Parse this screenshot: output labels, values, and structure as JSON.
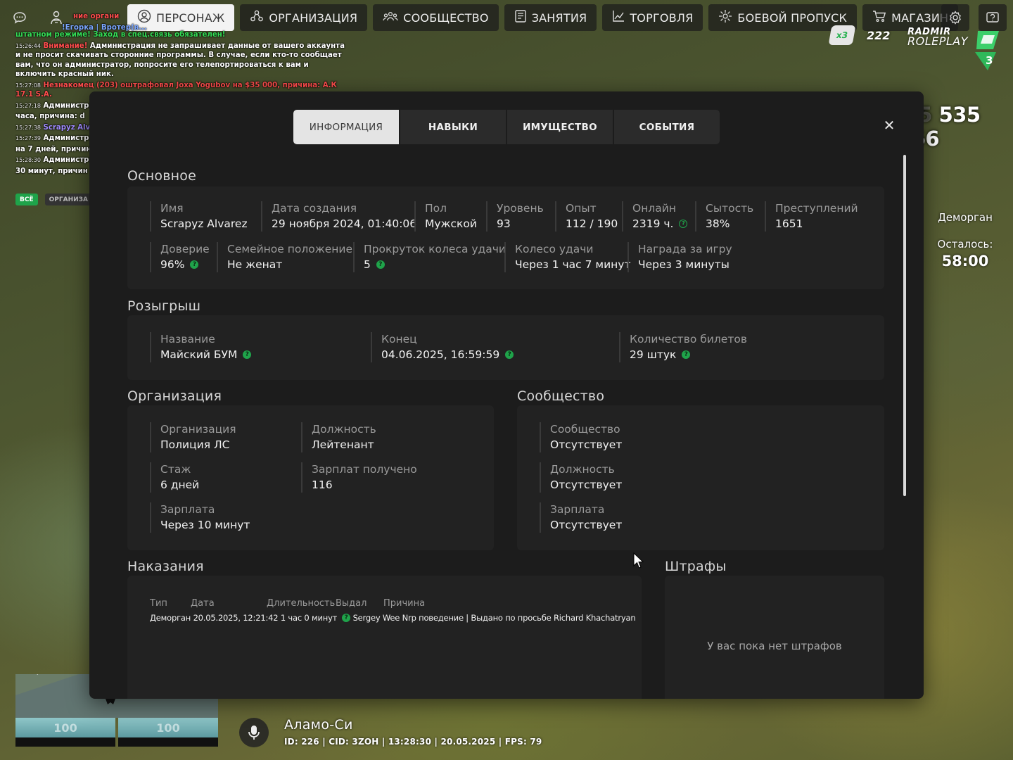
{
  "topbar": {
    "left_icons": [
      "chat-icon",
      "person-icon"
    ],
    "nav": [
      {
        "label": "ПЕРСОНАЖ",
        "icon": "user-icon",
        "active": true
      },
      {
        "label": "ОРГАНИЗАЦИЯ",
        "icon": "organization-icon"
      },
      {
        "label": "СООБЩЕСТВО",
        "icon": "community-icon"
      },
      {
        "label": "ЗАНЯТИЯ",
        "icon": "jobs-icon"
      },
      {
        "label": "ТОРГОВЛЯ",
        "icon": "chart-icon"
      },
      {
        "label": "БОЕВОЙ ПРОПУСК",
        "icon": "battlepass-icon"
      },
      {
        "label": "МАГАЗИН",
        "icon": "cart-icon"
      }
    ],
    "right_icons": [
      "settings-icon",
      "help-icon"
    ]
  },
  "chat": {
    "lines": [
      {
        "ts": "",
        "text": "ние органи",
        "color": "#ff4d4d"
      },
      {
        "ts": "",
        "text": "!Егорка | Вротер(в...",
        "color": "#7aa6ff"
      },
      {
        "ts": "",
        "text": "штатном режиме! Заход в спец.связь обязателен!",
        "color": "#33dd55"
      },
      {
        "ts": "15:26:44",
        "prefix": "Внимание!",
        "text": " Администрация не запрашивает данные от вашего аккаунта и не просит скачивать сторонние программы. В случае, если кто-то сообщает вам, что он администратор, попросите его телепортироваться к вам и включить красный ник.",
        "color": "#ffffff"
      },
      {
        "ts": "15:27:08",
        "prefix": "Незнакомец (203) оштрафовал Joxa Yogubov на $35 000, причина: А.К 17.1 S.A.",
        "text": "",
        "color": "#ff4d4d"
      },
      {
        "ts": "15:27:18",
        "prefix": "Администра",
        "text": "",
        "color": "#ffffff"
      },
      {
        "ts": "",
        "text": "часа, причина: d",
        "color": "#ffffff"
      },
      {
        "ts": "15:27:38",
        "prefix": "Scrapyz Alv",
        "text": "",
        "color": "#a18cff"
      },
      {
        "ts": "15:27:39",
        "prefix": "Администра",
        "text": "",
        "color": "#ffffff"
      },
      {
        "ts": "",
        "text": "на 7 дней, причин",
        "color": "#ffffff"
      },
      {
        "ts": "15:28:30",
        "prefix": "Администра",
        "text": "",
        "color": "#ffffff"
      },
      {
        "ts": "",
        "text": "30 минут, причин",
        "color": "#ffffff"
      }
    ],
    "tabs": [
      "ВСЁ",
      "ОРГАНИЗА"
    ]
  },
  "hud": {
    "multiplier": "x3",
    "points": "222",
    "logo_line1": "RADMIR",
    "logo_line2": "ROLEPLAY",
    "logo_badge": "3",
    "money_currency": "$ 5",
    "money": "535 366",
    "demorgan_label": "Деморган",
    "remaining_label": "Осталось:",
    "remaining_time": "58:00",
    "location": "Аламо-Си",
    "info": "ID: 226 | CID: 3ZOH | 13:28:30  | 20.05.2025 | FPS: 79",
    "minimap_bars": [
      "100",
      "100"
    ]
  },
  "modal": {
    "tabs": [
      {
        "label": "ИНФОРМАЦИЯ",
        "active": true
      },
      {
        "label": "НАВЫКИ"
      },
      {
        "label": "ИМУЩЕСТВО"
      },
      {
        "label": "СОБЫТИЯ"
      }
    ],
    "close": "✕",
    "basic": {
      "title": "Основное",
      "row1": [
        {
          "label": "Имя",
          "value": "Scrapyz Alvarez"
        },
        {
          "label": "Дата создания",
          "value": "29 ноября 2024, 01:40:06"
        },
        {
          "label": "Пол",
          "value": "Мужской"
        },
        {
          "label": "Уровень",
          "value": "93"
        },
        {
          "label": "Опыт",
          "value": "112 / 190"
        },
        {
          "label": "Онлайн",
          "value": "2319 ч."
        },
        {
          "label": "Сытость",
          "value": "38%"
        },
        {
          "label": "Преступлений",
          "value": "1651"
        }
      ],
      "row2": [
        {
          "label": "Доверие",
          "value": "96%"
        },
        {
          "label": "Семейное положение",
          "value": "Не женат"
        },
        {
          "label": "Прокруток колеса удачи",
          "value": "5"
        },
        {
          "label": "Колесо удачи",
          "value": "Через 1 час 7 минут"
        },
        {
          "label": "Награда за игру",
          "value": "Через 3 минуты"
        }
      ]
    },
    "raffle": {
      "title": "Розыгрыш",
      "fields": [
        {
          "label": "Название",
          "value": "Майский БУМ"
        },
        {
          "label": "Конец",
          "value": "04.06.2025, 16:59:59"
        },
        {
          "label": "Количество билетов",
          "value": "29 штук"
        }
      ]
    },
    "organization": {
      "title": "Организация",
      "fields": [
        {
          "label": "Организация",
          "value": "Полиция ЛС"
        },
        {
          "label": "Должность",
          "value": "Лейтенант"
        },
        {
          "label": "Стаж",
          "value": "6 дней"
        },
        {
          "label": "Зарплат получено",
          "value": "116"
        },
        {
          "label": "Зарплата",
          "value": "Через 10 минут"
        }
      ]
    },
    "community": {
      "title": "Сообщество",
      "fields": [
        {
          "label": "Сообщество",
          "value": "Отсутствует"
        },
        {
          "label": "Должность",
          "value": "Отсутствует"
        },
        {
          "label": "Зарплата",
          "value": "Отсутствует"
        }
      ]
    },
    "punishments": {
      "title": "Наказания",
      "headers": [
        "Тип",
        "Дата",
        "Длительность",
        "Выдал",
        "Причина"
      ],
      "rows": [
        {
          "type": "Деморган",
          "date": "20.05.2025, 12:21:42",
          "duration": "1 час 0 минут",
          "issuer": "Sergey Wee",
          "reason": "Nrp поведение | Выдано по просьбе Richard Khachatryan"
        }
      ]
    },
    "fines": {
      "title": "Штрафы",
      "empty": "У вас пока нет штрафов"
    }
  }
}
